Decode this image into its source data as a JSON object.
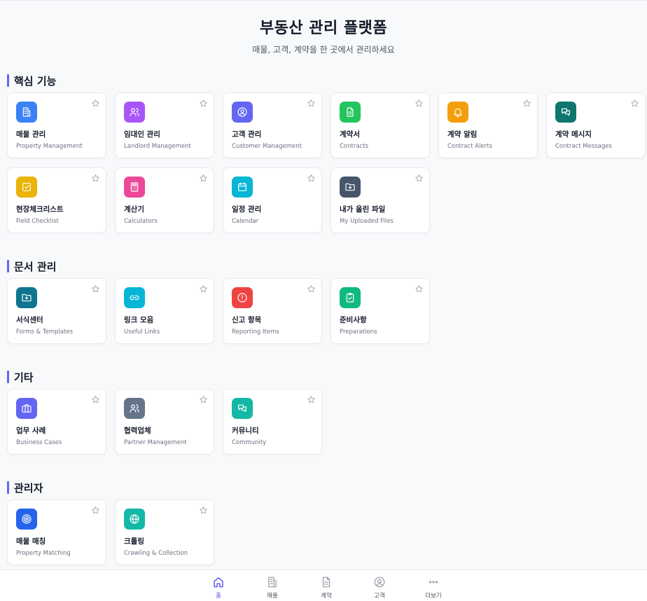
{
  "header": {
    "title": "부동산 관리 플랫폼",
    "subtitle": "매물, 고객, 계약을 한 곳에서 관리하세요"
  },
  "sections": [
    {
      "title": "핵심 기능",
      "accent": "#6366f1",
      "cards": [
        {
          "label": "매물 관리",
          "english": "Property Management",
          "icon": "building-icon",
          "color": "#3b82f6"
        },
        {
          "label": "임대인 관리",
          "english": "Landlord Management",
          "icon": "users-icon",
          "color": "#a855f7"
        },
        {
          "label": "고객 관리",
          "english": "Customer Management",
          "icon": "user-circle-icon",
          "color": "#6366f1"
        },
        {
          "label": "계약서",
          "english": "Contracts",
          "icon": "document-icon",
          "color": "#22c55e"
        },
        {
          "label": "계약 알림",
          "english": "Contract Alerts",
          "icon": "bell-icon",
          "color": "#f59e0b"
        },
        {
          "label": "계약 메시지",
          "english": "Contract Messages",
          "icon": "messages-icon",
          "color": "#0f766e"
        },
        {
          "label": "현장체크리스트",
          "english": "Field Checklist",
          "icon": "checkbox-icon",
          "color": "#eab308"
        },
        {
          "label": "계산기",
          "english": "Calculators",
          "icon": "calculator-icon",
          "color": "#ec4899"
        },
        {
          "label": "일정 관리",
          "english": "Calendar",
          "icon": "calendar-icon",
          "color": "#06b6d4"
        },
        {
          "label": "내가 올린 파일",
          "english": "My Uploaded Files",
          "icon": "folder-upload-icon",
          "color": "#475569"
        }
      ]
    },
    {
      "title": "문서 관리",
      "accent": "#6366f1",
      "cards": [
        {
          "label": "서식센터",
          "english": "Forms & Templates",
          "icon": "folder-download-icon",
          "color": "#0e7490"
        },
        {
          "label": "링크 모음",
          "english": "Useful Links",
          "icon": "link-icon",
          "color": "#06b6d4"
        },
        {
          "label": "신고 항목",
          "english": "Reporting Items",
          "icon": "alert-circle-icon",
          "color": "#ef4444"
        },
        {
          "label": "준비사항",
          "english": "Preparations",
          "icon": "clipboard-check-icon",
          "color": "#10b981"
        }
      ]
    },
    {
      "title": "기타",
      "accent": "#6366f1",
      "cards": [
        {
          "label": "업무 사례",
          "english": "Business Cases",
          "icon": "briefcase-icon",
          "color": "#6366f1"
        },
        {
          "label": "협력업체",
          "english": "Partner Management",
          "icon": "users-icon",
          "color": "#64748b"
        },
        {
          "label": "커뮤니티",
          "english": "Community",
          "icon": "messages-icon",
          "color": "#14b8a6"
        }
      ]
    },
    {
      "title": "관리자",
      "accent": "#6366f1",
      "cards": [
        {
          "label": "매물 매칭",
          "english": "Property Matching",
          "icon": "target-icon",
          "color": "#2563eb"
        },
        {
          "label": "크롤링",
          "english": "Crawling & Collection",
          "icon": "globe-icon",
          "color": "#14b8a6"
        }
      ]
    }
  ],
  "bottom_nav": {
    "items": [
      {
        "label": "홈",
        "icon": "home-icon",
        "active": true
      },
      {
        "label": "매물",
        "icon": "building-icon",
        "active": false
      },
      {
        "label": "계약",
        "icon": "document-icon",
        "active": false
      },
      {
        "label": "고객",
        "icon": "user-circle-icon",
        "active": false
      },
      {
        "label": "더보기",
        "icon": "more-icon",
        "active": false
      }
    ],
    "active_color": "#4f46e5",
    "inactive_color": "#9ca3af"
  }
}
